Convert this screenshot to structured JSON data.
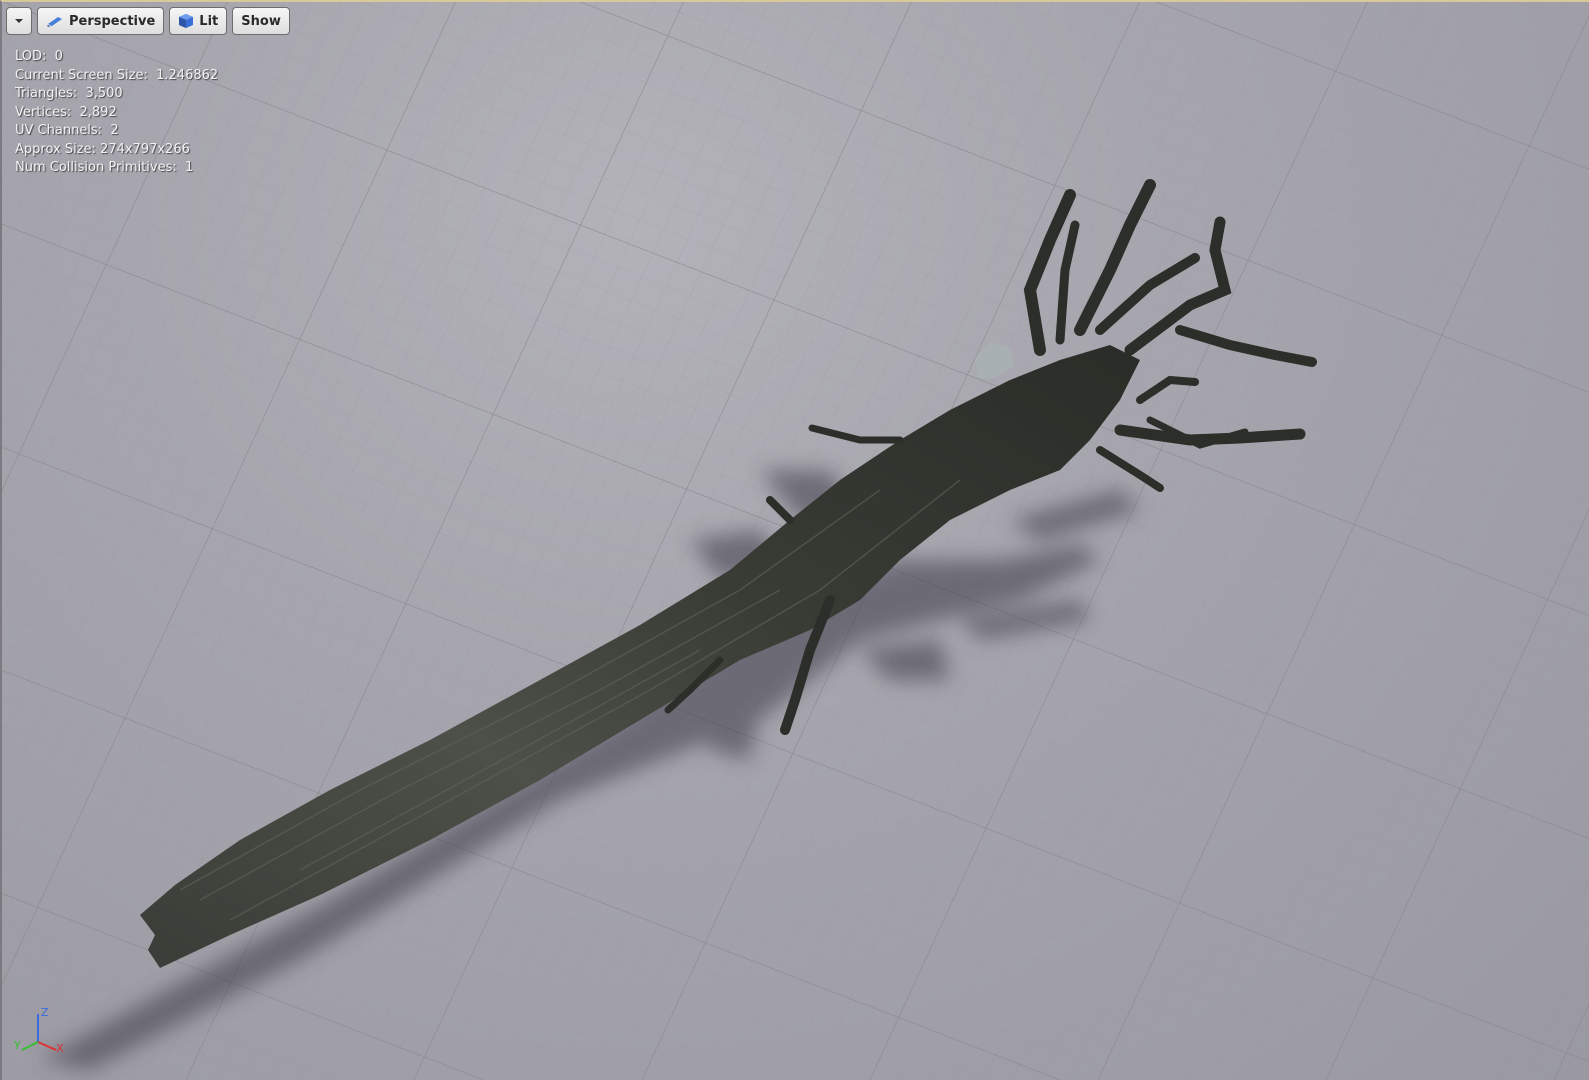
{
  "toolbar": {
    "options_menu_icon": "chevron-down-icon",
    "perspective_label": "Perspective",
    "perspective_icon": "camera-icon",
    "lit_label": "Lit",
    "lit_icon": "cube-icon",
    "show_label": "Show"
  },
  "stats": [
    {
      "label": "LOD:",
      "value": "0"
    },
    {
      "label": "Current Screen Size:",
      "value": "1.246862"
    },
    {
      "label": "Triangles:",
      "value": "3,500"
    },
    {
      "label": "Vertices:",
      "value": "2,892"
    },
    {
      "label": "UV Channels:",
      "value": "2"
    },
    {
      "label": "Approx Size:",
      "value": "274x797x266"
    },
    {
      "label": "Num Collision Primitives:",
      "value": "1"
    }
  ],
  "axis_indicator": {
    "x": "X",
    "y": "Y",
    "z": "Z"
  },
  "colors": {
    "ground": "#a6a5ad",
    "axis_x": "#e03030",
    "axis_y": "#30c030",
    "axis_z": "#3a6ae0",
    "mesh": "#2f322c"
  }
}
